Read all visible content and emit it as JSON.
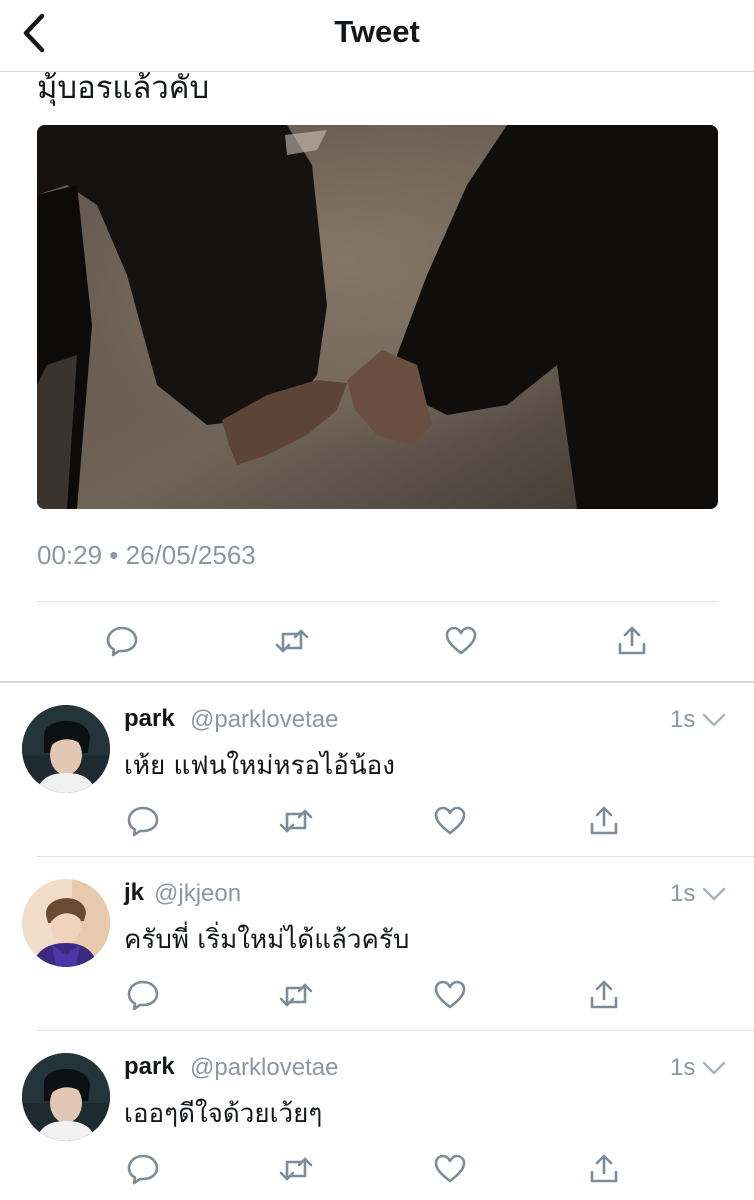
{
  "header": {
    "title": "Tweet",
    "back_icon": "chevron-left-icon"
  },
  "tweet": {
    "text": "มุ้บอรแล้วคับ",
    "media_description": "",
    "timestamp": "00:29 • 26/05/2563",
    "actions": [
      "reply-icon",
      "retweet-icon",
      "like-icon",
      "share-icon"
    ]
  },
  "replies": [
    {
      "name": "park",
      "handle": "@parklovetae",
      "time": "1s",
      "text": "เห้ย แฟนใหม่หรอไอ้น้อง"
    },
    {
      "name": "jk",
      "handle": "@jkjeon",
      "time": "1s",
      "text": "ครับพี่ เริ่มใหม่ได้แล้วครับ"
    },
    {
      "name": "park",
      "handle": "@parklovetae",
      "time": "1s",
      "text": "เออๆดีใจด้วยเว้ยๆ"
    }
  ],
  "colors": {
    "text": "#14171a",
    "secondary": "#8a98a5",
    "icon": "#7d8c99",
    "divider": "#dbe0e4"
  }
}
